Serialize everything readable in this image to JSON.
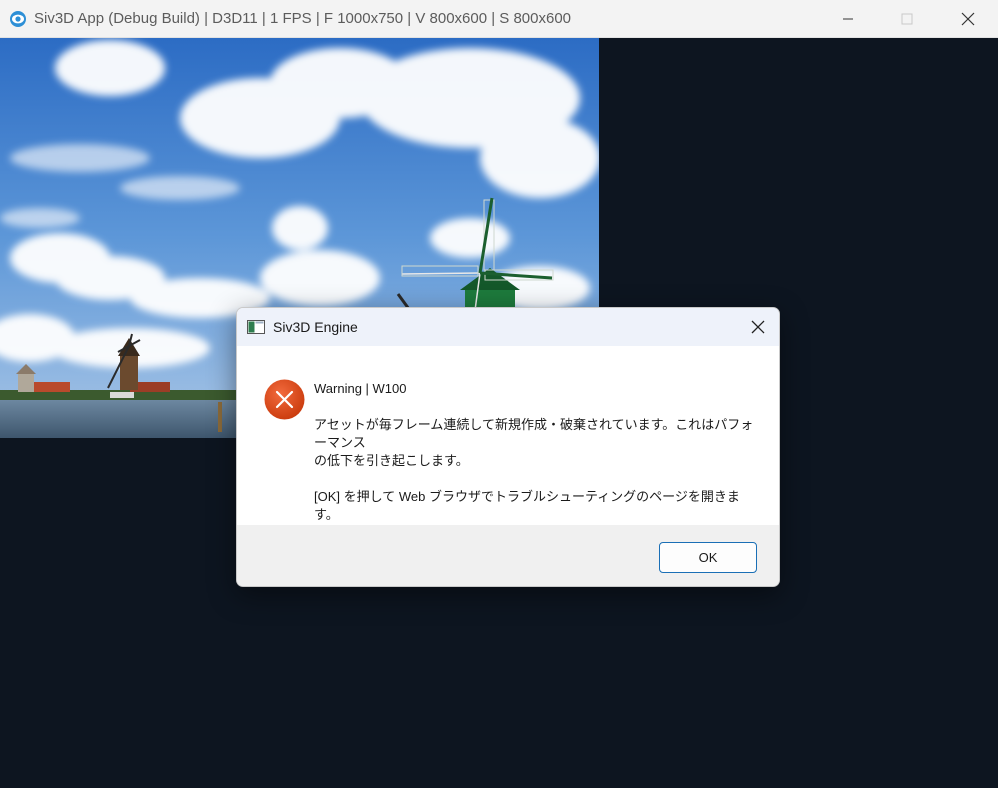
{
  "window": {
    "title": "Siv3D App (Debug Build) | D3D11 | 1 FPS | F 1000x750 | V 800x600 | S 800x600",
    "controls": {
      "minimize_icon": "minimize-icon",
      "maximize_icon": "maximize-icon",
      "close_icon": "close-icon"
    },
    "background_color": "#0d1520"
  },
  "scene": {
    "description_icon": "windmill-landscape-image"
  },
  "dialog": {
    "title": "Siv3D Engine",
    "icon": "error-icon",
    "heading": "Warning | W100",
    "message_line1": "アセットが毎フレーム連続して新規作成・破棄されています。これはパフォーマンス",
    "message_line2": "の低下を引き起こします。",
    "message_line3": "[OK] を押して Web ブラウザでトラブルシューティングのページを開きます。",
    "ok_label": "OK",
    "accent_color": "#1a6fb6",
    "error_color": "#d83b01"
  }
}
